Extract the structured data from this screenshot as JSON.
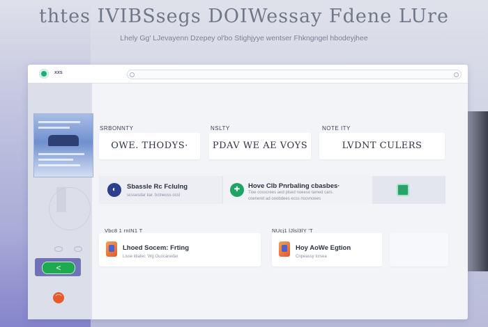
{
  "hero": {
    "title": "thtes IVIBSsegs DOIWessay Fdene LUre",
    "subtitle": "Lhely Gg' LJevayenn  Dzepey ol'bo Stighjyye wentser  Fhkngngel hbodeyjhee"
  },
  "window": {
    "app_name": "xxs"
  },
  "sidebar": {
    "back_label": "<",
    "orange_label": "⌒"
  },
  "stats": [
    {
      "label": "SRBONNTY",
      "value": "OWE. THODYS·"
    },
    {
      "label": "NSLTY",
      "value": "PDAV WE AE VOYS"
    },
    {
      "label": "NOTE ITY",
      "value": "LVDNT CULERS"
    }
  ],
  "rows": [
    {
      "title": "Sbassle Rc Fclulng",
      "subtitle": "scssesdar kar. bclneoss ocsl",
      "icon": "◐"
    },
    {
      "title": "Hove Clb Pnrbaling cbasbes·",
      "subtitle": "Tioe cosscrees aed plsed noeeso tamed cars.\ncoeneret ad ooobdees ecss nscvnoees",
      "icon": "✚"
    }
  ],
  "sections": [
    {
      "label": "Vbc8 1 rnIN1 T"
    },
    {
      "label": "NUcj1 lJlsl3lY 'T"
    }
  ],
  "features": [
    {
      "title": "Lhoed Socem: Frting",
      "subtitle": "Lisse ldiatec 'Wg Ouocanedar"
    },
    {
      "title": "Hoy AoWe Egtion",
      "subtitle": "Cnpeassy tcrsea"
    }
  ],
  "colors": {
    "accent_green": "#1eaa4e",
    "accent_orange": "#e65a2c",
    "sidebar_accent": "#6e73b8"
  }
}
